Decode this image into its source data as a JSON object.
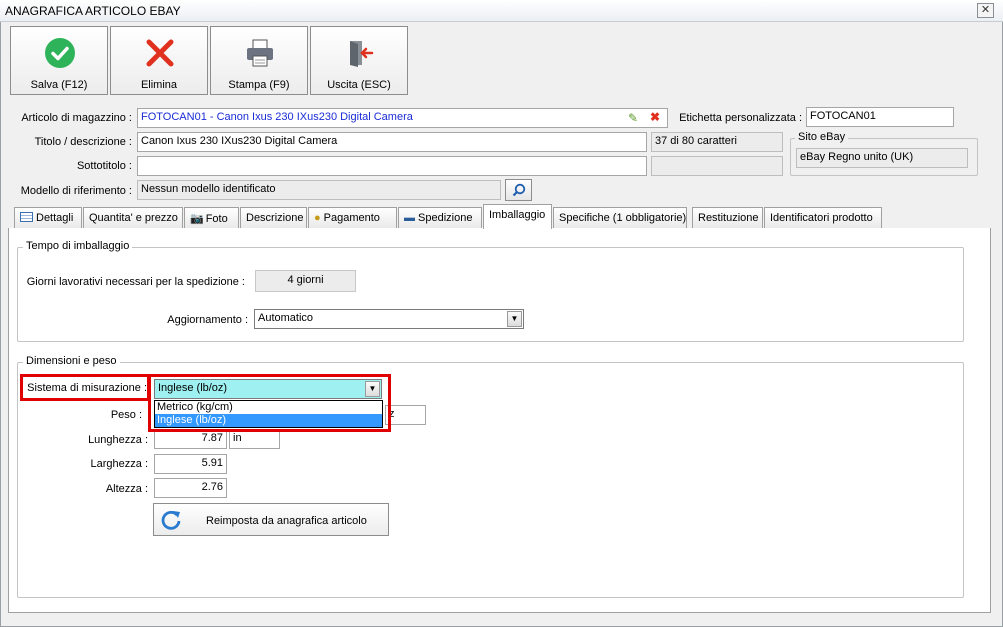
{
  "window": {
    "title": "ANAGRAFICA ARTICOLO EBAY",
    "close": "✕"
  },
  "toolbar": {
    "save": "Salva (F12)",
    "delete": "Elimina",
    "print": "Stampa (F9)",
    "exit": "Uscita (ESC)"
  },
  "header": {
    "item_label": "Articolo di magazzino :",
    "item_value": "FOTOCAN01 - Canon Ixus 230 IXus230 Digital Camera",
    "custom_label_label": "Etichetta personalizzata :",
    "custom_label_value": "FOTOCAN01",
    "title_label": "Titolo / descrizione :",
    "title_value": "Canon Ixus 230 IXus230 Digital Camera",
    "title_count": "37 di 80 caratteri",
    "subtitle_label": "Sottotitolo :",
    "subtitle_value": "",
    "model_label": "Modello di riferimento :",
    "model_value": "Nessun modello identificato",
    "site_group": "Sito eBay",
    "site_value": "eBay Regno unito (UK)"
  },
  "tabs": [
    {
      "label": "Dettagli"
    },
    {
      "label": "Quantita' e prezzo"
    },
    {
      "label": "Foto"
    },
    {
      "label": "Descrizione"
    },
    {
      "label": "Pagamento"
    },
    {
      "label": "Spedizione"
    },
    {
      "label": "Imballaggio"
    },
    {
      "label": "Specifiche (1 obbligatorie)"
    },
    {
      "label": "Restituzione"
    },
    {
      "label": "Identificatori prodotto"
    }
  ],
  "packaging": {
    "group_title": "Tempo di imballaggio",
    "days_label": "Giorni lavorativi necessari per la spedizione :",
    "days_value": "4 giorni",
    "update_label": "Aggiornamento :",
    "update_value": "Automatico"
  },
  "dimensions": {
    "group_title": "Dimensioni e peso",
    "system_label": "Sistema di misurazione :",
    "system_value": "Inglese (lb/oz)",
    "options": [
      "Metrico (kg/cm)",
      "Inglese (lb/oz)"
    ],
    "weight_label": "Peso :",
    "weight_unit_partial": "z",
    "length_label": "Lunghezza :",
    "length_value": "7.87",
    "length_unit": "in",
    "width_label": "Larghezza :",
    "width_value": "5.91",
    "height_label": "Altezza :",
    "height_value": "2.76",
    "reset_button": "Reimposta da anagrafica articolo"
  },
  "colors": {
    "accent_red": "#e00000",
    "selection": "#3399ff",
    "combo_highlight": "#9ff0f0",
    "link": "#1a2bd6"
  }
}
